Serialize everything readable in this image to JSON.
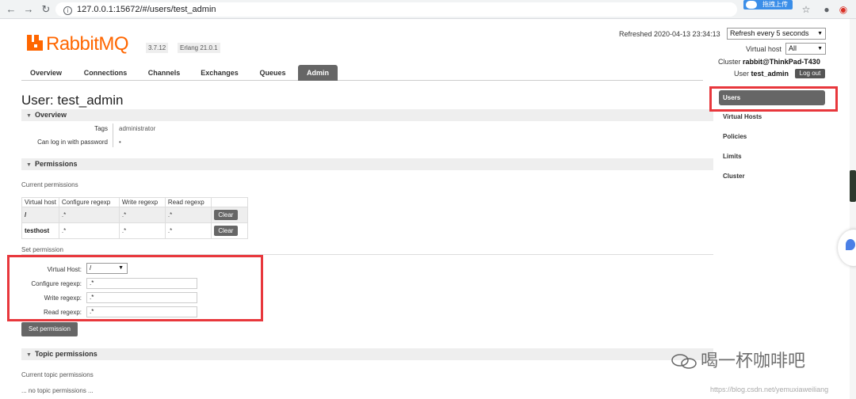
{
  "browser": {
    "url": "127.0.0.1:15672/#/users/test_admin",
    "extension_label": "拖拽上传"
  },
  "header": {
    "logo_text": "RabbitMQ",
    "rabbitmq_version": "3.7.12",
    "erlang_version": "Erlang 21.0.1",
    "refreshed_text": "Refreshed 2020-04-13 23:34:13",
    "refresh_select": "Refresh every 5 seconds",
    "virtual_host_label": "Virtual host",
    "virtual_host_value": "All",
    "cluster_label": "Cluster",
    "cluster_value": "rabbit@ThinkPad-T430",
    "user_label": "User",
    "user_value": "test_admin",
    "logout_label": "Log out"
  },
  "tabs": [
    {
      "label": "Overview"
    },
    {
      "label": "Connections"
    },
    {
      "label": "Channels"
    },
    {
      "label": "Exchanges"
    },
    {
      "label": "Queues"
    },
    {
      "label": "Admin"
    }
  ],
  "page": {
    "title": "User: test_admin",
    "overview_section": "Overview",
    "tags_label": "Tags",
    "tags_value": "administrator",
    "login_label": "Can log in with password",
    "login_value": "•",
    "permissions_section": "Permissions",
    "current_permissions": "Current permissions",
    "table_headers": [
      "Virtual host",
      "Configure regexp",
      "Write regexp",
      "Read regexp"
    ],
    "table_rows": [
      {
        "host": "/",
        "configure": ".*",
        "write": ".*",
        "read": ".*",
        "action": "Clear"
      },
      {
        "host": "testhost",
        "configure": ".*",
        "write": ".*",
        "read": ".*",
        "action": "Clear"
      }
    ],
    "set_permission_heading": "Set permission",
    "form": {
      "vhost_label": "Virtual Host:",
      "vhost_value": "/",
      "configure_label": "Configure regexp:",
      "configure_value": ".*",
      "write_label": "Write regexp:",
      "write_value": ".*",
      "read_label": "Read regexp:",
      "read_value": ".*",
      "submit_label": "Set permission"
    },
    "topic_section": "Topic permissions",
    "current_topic_permissions": "Current topic permissions",
    "no_topic_permissions": "... no topic permissions ..."
  },
  "sidebar": {
    "items": [
      {
        "label": "Users"
      },
      {
        "label": "Virtual Hosts"
      },
      {
        "label": "Policies"
      },
      {
        "label": "Limits"
      },
      {
        "label": "Cluster"
      }
    ]
  },
  "watermark": {
    "text": "喝一杯咖啡吧",
    "source": "https://blog.csdn.net/yemuxiaweiliang"
  },
  "colors": {
    "brand": "#ff6600",
    "highlight_box": "#e8373c",
    "active_tab": "#666666"
  }
}
